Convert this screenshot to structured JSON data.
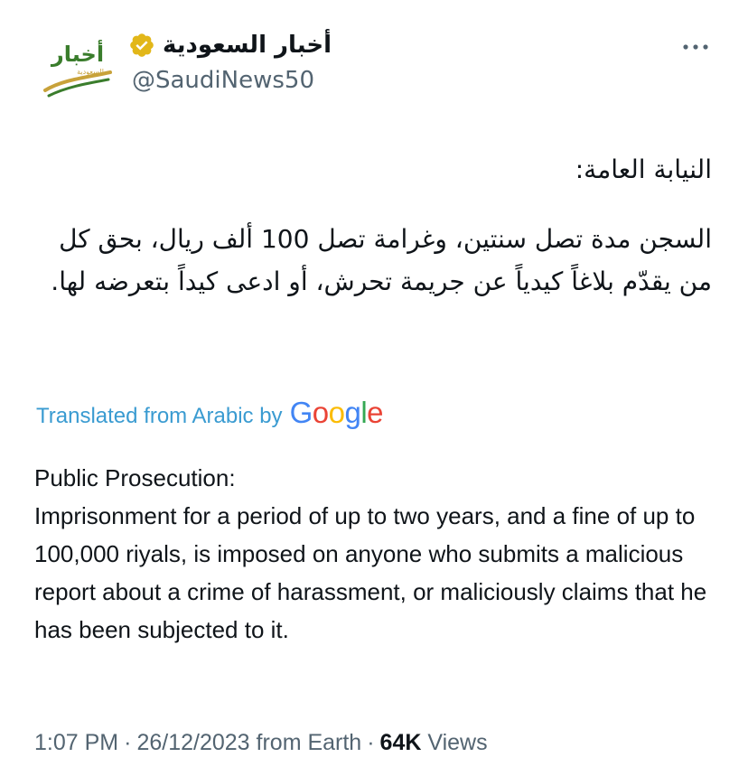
{
  "author": {
    "display_name": "أخبار السعودية",
    "handle": "@SaudiNews50",
    "avatar_text_ar": "أخبار",
    "avatar_subtext_ar": "السعودية",
    "verified": "gold",
    "verified_color": "#e2b719"
  },
  "tweet": {
    "heading_ar": "النيابة العامة:",
    "body_ar": "السجن مدة تصل سنتين، وغرامة تصل 100 ألف ريال، بحق كل من يقدّم بلاغاً كيدياً عن جريمة تحرش، أو ادعى كيداً بتعرضه لها."
  },
  "translation": {
    "label": "Translated from Arabic by",
    "provider_letters": [
      "G",
      "o",
      "o",
      "g",
      "l",
      "e"
    ],
    "provider_colors": [
      "#4285f4",
      "#ea4335",
      "#fbbc05",
      "#4285f4",
      "#34a853",
      "#ea4335"
    ],
    "heading_en": "Public Prosecution:",
    "body_en": "Imprisonment for a period of up to two years, and a fine of up to 100,000 riyals, is imposed on anyone who submits a malicious report about a crime of harassment, or maliciously claims that he has been subjected to it."
  },
  "meta": {
    "time": "1:07 PM",
    "date": "26/12/2023",
    "source": "from Earth",
    "separator": "·",
    "views_count": "64K",
    "views_label": "Views"
  },
  "icons": {
    "more": "more-icon",
    "verified": "verified-badge-icon"
  },
  "colors": {
    "text_primary": "#0f1419",
    "text_secondary": "#536471",
    "link": "#3a9bd1"
  }
}
